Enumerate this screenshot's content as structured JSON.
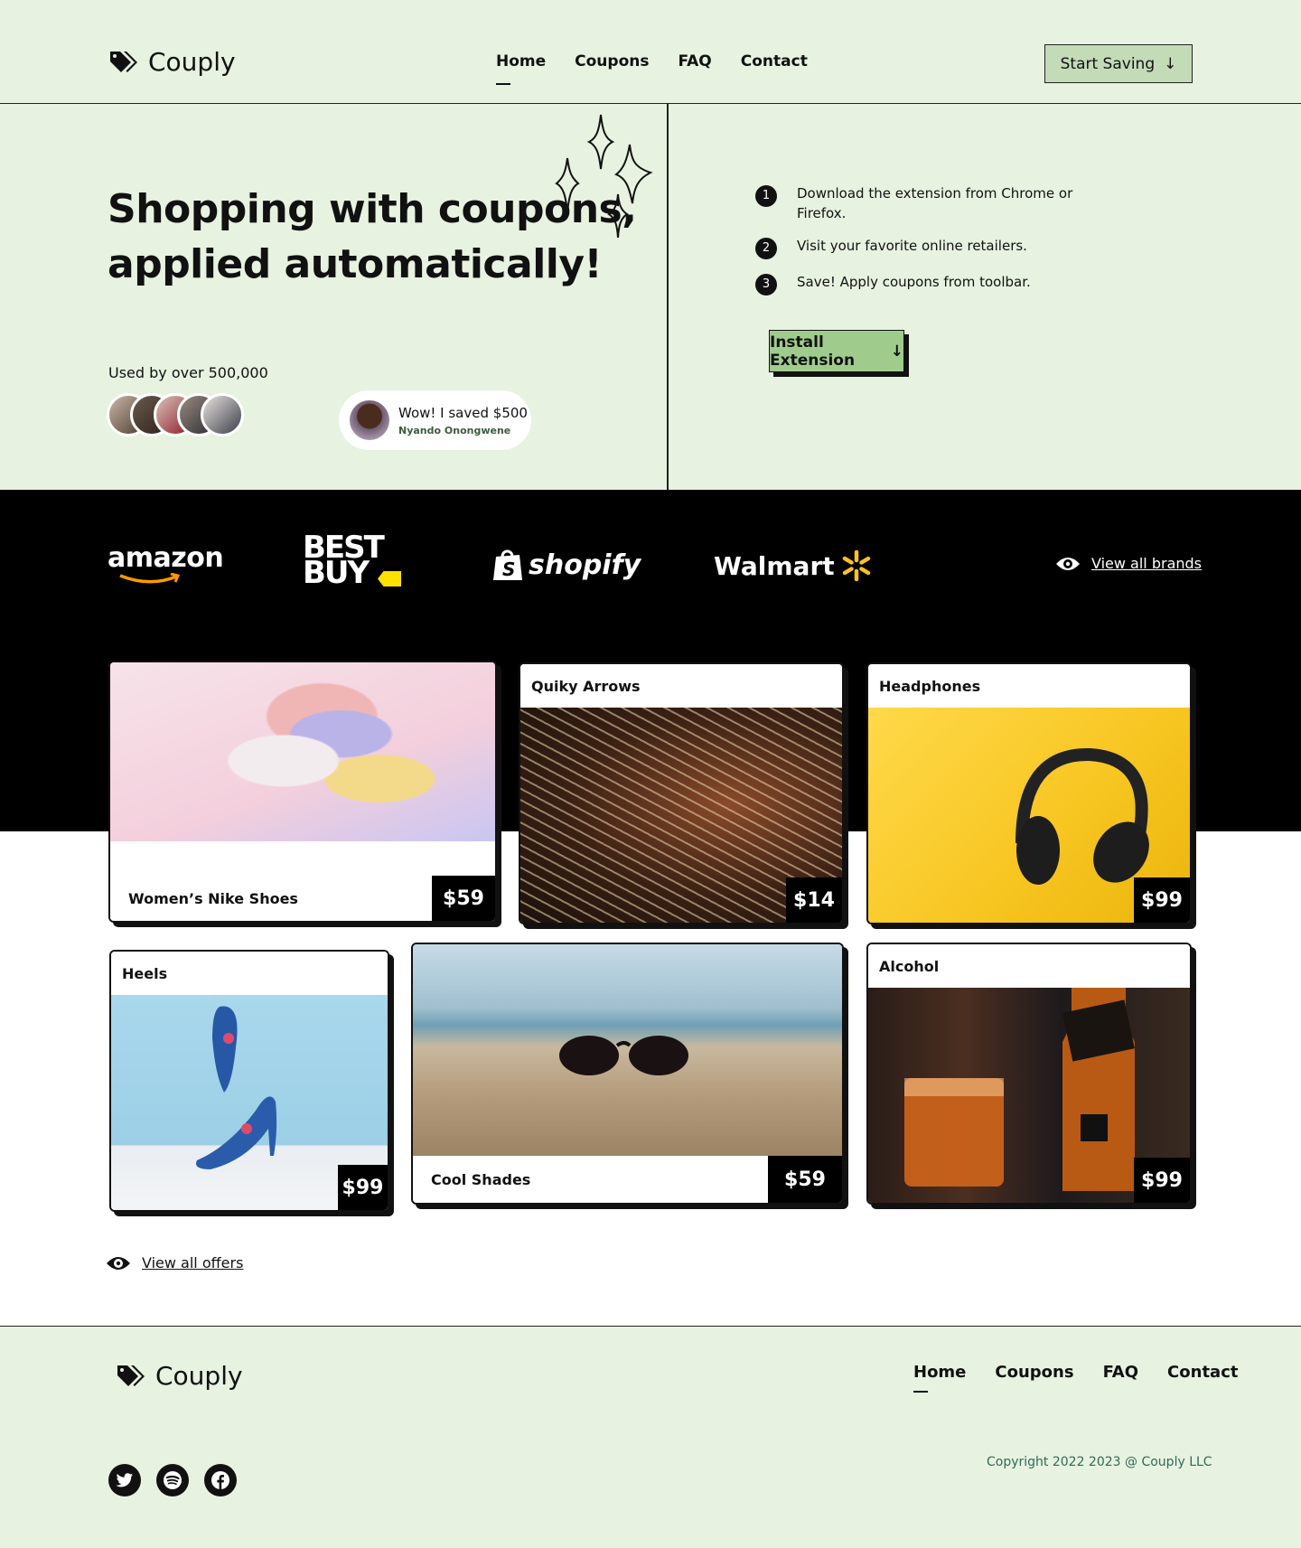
{
  "header": {
    "logo_icon": "price-tag-icon",
    "brand": "Couply",
    "nav": [
      "Home",
      "Coupons",
      "FAQ",
      "Contact"
    ],
    "cta": "Start Saving",
    "cta_icon": "arrow-down-icon"
  },
  "hero": {
    "headline_line1": "Shopping with coupons,",
    "headline_line2": "applied automatically!",
    "used_by": "Used by over 500,000",
    "testimonial": {
      "quote": "Wow! I saved $500",
      "name": "Nyando Onongwene"
    },
    "steps": [
      {
        "num": "1",
        "text": "Download the extension from Chrome or Firefox."
      },
      {
        "num": "2",
        "text": "Visit your favorite online retailers."
      },
      {
        "num": "3",
        "text": "Save! Apply coupons from toolbar."
      }
    ],
    "install": "Install Extension"
  },
  "brands": {
    "items": [
      "amazon",
      "BEST BUY",
      "shopify",
      "Walmart"
    ],
    "view_all": "View all brands",
    "view_icon": "eye-icon"
  },
  "products": [
    {
      "title": "Women’s Nike Shoes",
      "price": "$59"
    },
    {
      "title": "Quiky Arrows",
      "price": "$14"
    },
    {
      "title": "Headphones",
      "price": "$99"
    },
    {
      "title": "Heels",
      "price": "$99"
    },
    {
      "title": "Cool Shades",
      "price": "$59"
    },
    {
      "title": "Alcohol",
      "price": "$99"
    }
  ],
  "view_offers": "View all offers",
  "footer": {
    "brand": "Couply",
    "nav": [
      "Home",
      "Coupons",
      "FAQ",
      "Contact"
    ],
    "socials": [
      "twitter-icon",
      "spotify-icon",
      "facebook-icon"
    ],
    "copyright": "Copyright 2022 2023 @ Couply LLC"
  },
  "colors": {
    "bg_green": "#e7f2e0",
    "button_green": "#9fcc8c",
    "start_green": "#c3dbb7",
    "dark": "#000000"
  }
}
